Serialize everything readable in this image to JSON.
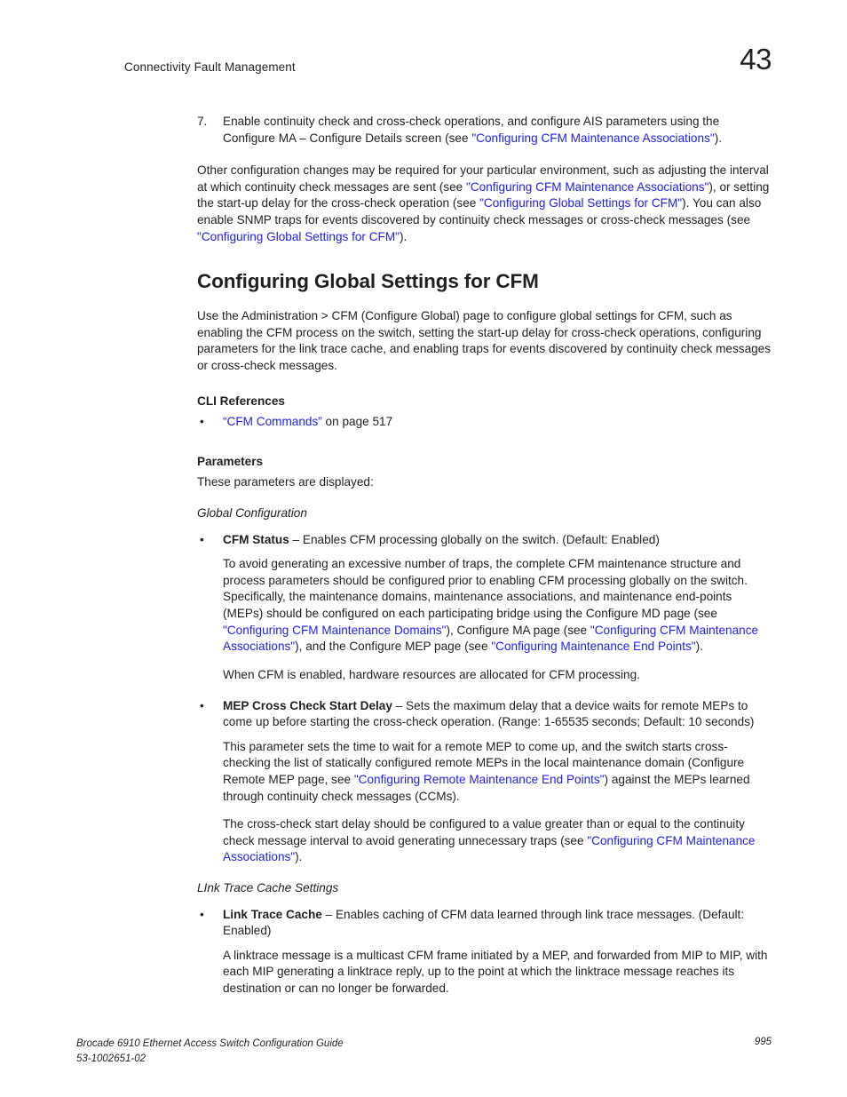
{
  "header": {
    "chapter_title": "Connectivity Fault Management",
    "chapter_number": "43"
  },
  "body": {
    "step7": {
      "marker": "7.",
      "text_1": "Enable continuity check and cross-check operations, and configure AIS parameters using the Configure MA – Configure Details screen (see ",
      "link_1": "\"Configuring CFM Maintenance Associations\"",
      "text_2": ")."
    },
    "intro_para": {
      "text_1": "Other configuration changes may be required for your particular environment, such as adjusting the interval at which continuity check messages are sent (see ",
      "link_1": "\"Configuring CFM Maintenance Associations\"",
      "text_2": "), or setting the start-up delay for the cross-check operation (see ",
      "link_2": "\"Configuring Global Settings for CFM\"",
      "text_3": "). You can also enable SNMP traps for events discovered by continuity check messages or cross-check messages (see ",
      "link_3": "\"Configuring Global Settings for CFM\"",
      "text_4": ")."
    },
    "section_title": "Configuring Global Settings for CFM",
    "section_intro": "Use the Administration > CFM (Configure Global) page to configure global settings for CFM, such as enabling the CFM process on the switch, setting the start-up delay for cross-check operations, configuring parameters for the link trace cache, and enabling traps for events discovered by continuity check messages or cross-check messages.",
    "cli_references": {
      "heading": "CLI References",
      "bullet": "•",
      "link": "“CFM Commands”",
      "text_after": " on page 517"
    },
    "parameters": {
      "heading": "Parameters",
      "intro": "These parameters are displayed:"
    },
    "global_configuration_head": "Global Configuration",
    "cfm_status": {
      "bullet": "•",
      "label": "CFM Status",
      "desc": " – Enables CFM processing globally on the switch. (Default: Enabled)",
      "para_1_text_1": "To avoid generating an excessive number of traps, the complete CFM maintenance structure and process parameters should be configured prior to enabling CFM processing globally on the switch. Specifically, the maintenance domains, maintenance associations, and maintenance end-points (MEPs) should be configured on each participating bridge using the Configure MD page (see ",
      "para_1_link_1": "\"Configuring CFM Maintenance Domains\"",
      "para_1_text_2": "), Configure MA page (see ",
      "para_1_link_2": "\"Configuring CFM Maintenance Associations\"",
      "para_1_text_3": "), and the Configure MEP page (see ",
      "para_1_link_3": "\"Configuring Maintenance End Points\"",
      "para_1_text_4": ").",
      "para_2": "When CFM is enabled, hardware resources are allocated for CFM processing."
    },
    "mep_cross_check": {
      "bullet": "•",
      "label": "MEP Cross Check Start Delay",
      "desc": " – Sets the maximum delay that a device waits for remote MEPs to come up before starting the cross-check operation. (Range: 1-65535 seconds; Default: 10 seconds)",
      "para_1_text_1": "This parameter sets the time to wait for a remote MEP to come up, and the switch starts cross-checking the list of statically configured remote MEPs in the local maintenance domain (Configure Remote MEP page, see ",
      "para_1_link_1": "\"Configuring Remote Maintenance End Points\"",
      "para_1_text_2": ") against the MEPs learned through continuity check messages (CCMs).",
      "para_2_text_1": "The cross-check start delay should be configured to a value greater than or equal to the continuity check message interval to avoid generating unnecessary traps (see ",
      "para_2_link_1": "\"Configuring CFM Maintenance Associations\"",
      "para_2_text_2": ")."
    },
    "link_trace_cache_settings_head": "LInk Trace Cache Settings",
    "link_trace_cache": {
      "bullet": "•",
      "label": "Link Trace Cache",
      "desc": " – Enables caching of CFM data learned through link trace messages. (Default: Enabled)",
      "para_1": "A linktrace message is a multicast CFM frame initiated by a MEP, and forwarded from MIP to MIP, with each MIP generating a linktrace reply, up to the point at which the linktrace message reaches its destination or can no longer be forwarded."
    }
  },
  "footer": {
    "guide_line_1": "Brocade 6910 Ethernet Access Switch Configuration Guide",
    "guide_line_2": "53-1002651-02",
    "page_number": "995"
  },
  "colors": {
    "link": "#2020ee",
    "text": "#231f20",
    "background": "#ffffff"
  }
}
